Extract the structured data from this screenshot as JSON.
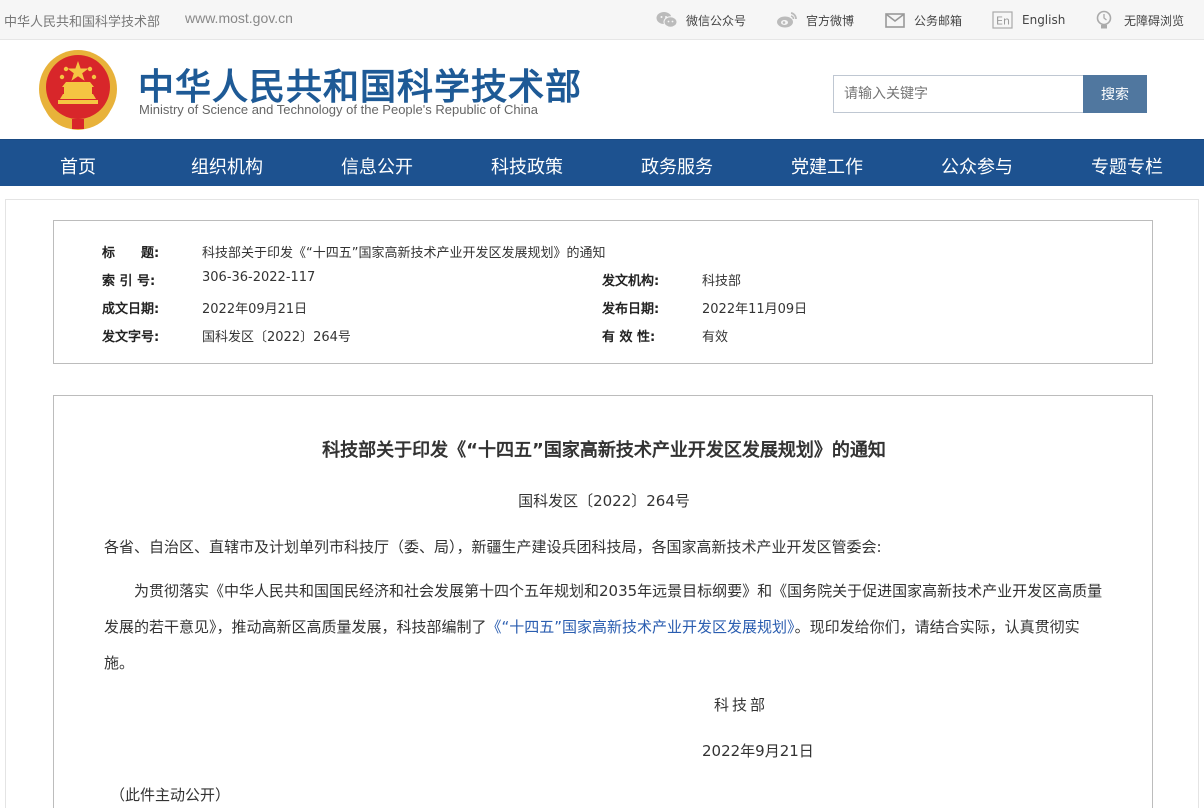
{
  "topbar": {
    "site_name": "中华人民共和国科学技术部",
    "url": "www.most.gov.cn",
    "tools": [
      {
        "label": "微信公众号",
        "icon": "wechat-icon"
      },
      {
        "label": "官方微博",
        "icon": "weibo-icon"
      },
      {
        "label": "公务邮箱",
        "icon": "mail-icon"
      },
      {
        "label": "English",
        "icon": "english-icon"
      },
      {
        "label": "无障碍浏览",
        "icon": "accessibility-icon"
      }
    ]
  },
  "header": {
    "title_cn": "中华人民共和国科学技术部",
    "title_en": "Ministry of Science and Technology of the People's Republic of China",
    "search_placeholder": "请输入关键字",
    "search_button": "搜索"
  },
  "nav": {
    "items": [
      "首页",
      "组织机构",
      "信息公开",
      "科技政策",
      "政务服务",
      "党建工作",
      "公众参与",
      "专题专栏"
    ]
  },
  "meta": {
    "title_label": "标　　题:",
    "title_value": "科技部关于印发《“十四五”国家高新技术产业开发区发展规划》的通知",
    "index_label": "索 引 号:",
    "index_value": "306-36-2022-117",
    "issuer_label": "发文机构:",
    "issuer_value": "科技部",
    "created_label": "成文日期:",
    "created_value": "2022年09月21日",
    "published_label": "发布日期:",
    "published_value": "2022年11月09日",
    "docno_label": "发文字号:",
    "docno_value": "国科发区〔2022〕264号",
    "validity_label": "有 效 性:",
    "validity_value": "有效"
  },
  "document": {
    "title": "科技部关于印发《“十四五”国家高新技术产业开发区发展规划》的通知",
    "number": "国科发区〔2022〕264号",
    "addressee": "各省、自治区、直辖市及计划单列市科技厅（委、局），新疆生产建设兵团科技局，各国家高新技术产业开发区管委会:",
    "body_before": "为贯彻落实《中华人民共和国国民经济和社会发展第十四个五年规划和2035年远景目标纲要》和《国务院关于促进国家高新技术产业开发区高质量发展的若干意见》，推动高新区高质量发展，科技部编制了",
    "body_link": "《“十四五”国家高新技术产业开发区发展规划》",
    "body_after": "。现印发给你们，请结合实际，认真贯彻实施。",
    "signature": "科技部",
    "date": "2022年9月21日",
    "note": "（此件主动公开）"
  },
  "colors": {
    "nav_bg": "#1d5290",
    "title_blue": "#1e5a96",
    "search_btn": "#50779f",
    "link": "#2a5db0"
  }
}
